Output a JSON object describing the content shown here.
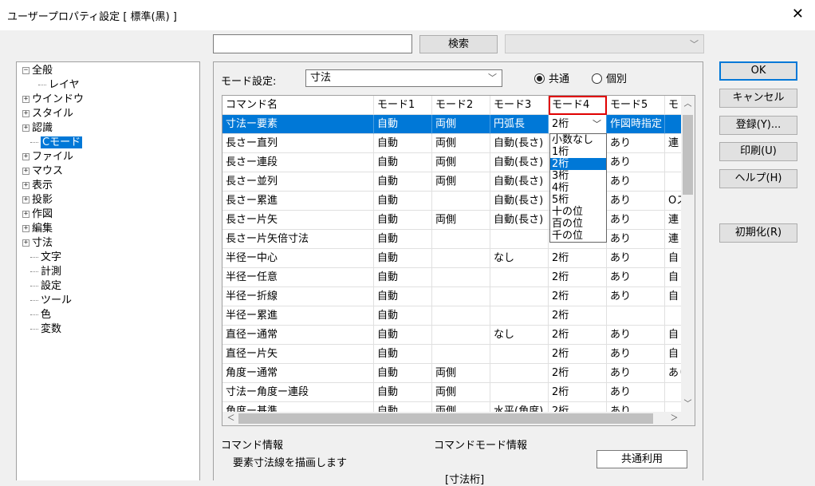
{
  "window": {
    "title": "ユーザープロパティ設定 [ 標準(黒) ]",
    "close_icon": "close-icon"
  },
  "search": {
    "button_label": "検索",
    "value": ""
  },
  "tree": {
    "items": [
      {
        "label": "全般",
        "expander": "⊟",
        "indent": 0
      },
      {
        "label": "レイヤ",
        "expander": "",
        "indent": 2
      },
      {
        "label": "ウインドウ",
        "expander": "⊞",
        "indent": 0
      },
      {
        "label": "スタイル",
        "expander": "⊞",
        "indent": 0
      },
      {
        "label": "認識",
        "expander": "⊞",
        "indent": 0
      },
      {
        "label": "Cモード",
        "expander": "",
        "indent": 1,
        "selected": true
      },
      {
        "label": "ファイル",
        "expander": "⊞",
        "indent": 0
      },
      {
        "label": "マウス",
        "expander": "⊞",
        "indent": 0
      },
      {
        "label": "表示",
        "expander": "⊞",
        "indent": 0
      },
      {
        "label": "投影",
        "expander": "⊞",
        "indent": 0
      },
      {
        "label": "作図",
        "expander": "⊞",
        "indent": 0
      },
      {
        "label": "編集",
        "expander": "⊞",
        "indent": 0
      },
      {
        "label": "寸法",
        "expander": "⊞",
        "indent": 0
      },
      {
        "label": "文字",
        "expander": "",
        "indent": 1
      },
      {
        "label": "計測",
        "expander": "",
        "indent": 1
      },
      {
        "label": "設定",
        "expander": "",
        "indent": 1
      },
      {
        "label": "ツール",
        "expander": "",
        "indent": 1
      },
      {
        "label": "色",
        "expander": "",
        "indent": 1
      },
      {
        "label": "変数",
        "expander": "",
        "indent": 1
      }
    ]
  },
  "mode": {
    "label": "モード設定:",
    "selected": "寸法",
    "radio_common": "共通",
    "radio_individual": "個別",
    "radio_selected": "common"
  },
  "grid": {
    "columns": [
      "コマンド名",
      "モード1",
      "モード2",
      "モード3",
      "モード4",
      "モード5",
      "モ"
    ],
    "rows": [
      [
        "寸法ー要素",
        "自動",
        "両側",
        "円弧長",
        "2桁",
        "作図時指定",
        ""
      ],
      [
        "長さー直列",
        "自動",
        "両側",
        "自動(長さ)",
        "",
        "あり",
        "連"
      ],
      [
        "長さー連段",
        "自動",
        "両側",
        "自動(長さ)",
        "",
        "あり",
        ""
      ],
      [
        "長さー並列",
        "自動",
        "両側",
        "自動(長さ)",
        "",
        "あり",
        ""
      ],
      [
        "長さー累進",
        "自動",
        "",
        "自動(長さ)",
        "",
        "あり",
        "Oス"
      ],
      [
        "長さー片矢",
        "自動",
        "両側",
        "自動(長さ)",
        "",
        "あり",
        "連"
      ],
      [
        "長さー片矢倍寸法",
        "自動",
        "",
        "",
        "",
        "あり",
        "連"
      ],
      [
        "半径ー中心",
        "自動",
        "",
        "なし",
        "2桁",
        "あり",
        "自"
      ],
      [
        "半径ー任意",
        "自動",
        "",
        "",
        "2桁",
        "あり",
        "自"
      ],
      [
        "半径ー折線",
        "自動",
        "",
        "",
        "2桁",
        "あり",
        "自"
      ],
      [
        "半径ー累進",
        "自動",
        "",
        "",
        "2桁",
        "",
        ""
      ],
      [
        "直径ー通常",
        "自動",
        "",
        "なし",
        "2桁",
        "あり",
        "自"
      ],
      [
        "直径ー片矢",
        "自動",
        "",
        "",
        "2桁",
        "あり",
        "自"
      ],
      [
        "角度ー通常",
        "自動",
        "両側",
        "",
        "2桁",
        "あり",
        "あり"
      ],
      [
        "寸法ー角度ー連段",
        "自動",
        "両側",
        "",
        "2桁",
        "あり",
        ""
      ],
      [
        "角度ー基準",
        "自動",
        "両側",
        "水平(角度)",
        "2桁",
        "あり",
        ""
      ]
    ],
    "dropdown_options": [
      "小数なし",
      "1桁",
      "2桁",
      "3桁",
      "4桁",
      "5桁",
      "十の位",
      "百の位",
      "千の位"
    ],
    "dropdown_selected": "2桁"
  },
  "info": {
    "command_info_title": "コマンド情報",
    "command_info_text": "要素寸法線を描画します",
    "command_mode_title": "コマンドモード情報",
    "common_button": "共通利用",
    "bottom_text": "[寸法桁]"
  },
  "buttons": {
    "ok": "OK",
    "cancel": "キャンセル",
    "register": "登録(Y)...",
    "print": "印刷(U)",
    "help": "ヘルプ(H)",
    "reset": "初期化(R)"
  },
  "colors": {
    "selection": "#0078d7",
    "highlight_border": "#e00000"
  }
}
